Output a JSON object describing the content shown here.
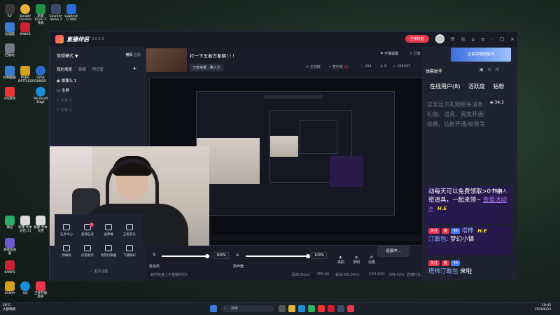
{
  "desktop": {
    "icons": [
      {
        "label": "TuF",
        "color": "#3a3a3a"
      },
      {
        "label": "Google Chrome",
        "color": "#e8b13a"
      },
      {
        "label": "新建 XLSX 工作表",
        "color": "#1f8f4a"
      },
      {
        "label": "Counter-Strike 2",
        "color": "#3b4a6b"
      },
      {
        "label": "Logitech G HUB",
        "color": "#2a6bd1"
      },
      {
        "label": "此电脑",
        "color": "#3a7bd5"
      },
      {
        "label": "KANAS",
        "color": "#c23"
      },
      {
        "label": "回收站",
        "color": "#778"
      },
      {
        "label": "控制面板",
        "color": "#3a7bd5"
      },
      {
        "label": "PUBG BATTLEGROUNDS",
        "color": "#d4a020"
      },
      {
        "label": "Orbit",
        "color": "#2a6bd1"
      },
      {
        "label": "QQ游戏",
        "color": "#e33"
      },
      {
        "label": "Microsoft Edge",
        "color": "#1b8dd8"
      },
      {
        "label": "微信",
        "color": "#2aae67"
      },
      {
        "label": "新建 文本文档 (2)",
        "color": "#ddd"
      },
      {
        "label": "新建 文本文档",
        "color": "#ddd"
      },
      {
        "label": "游戏加速器",
        "color": "#6a5acd"
      },
      {
        "label": "KANAS",
        "color": "#c23"
      },
      {
        "label": "SANYA",
        "color": "#d4a020"
      },
      {
        "label": "QQ",
        "color": "#1b8dd8"
      },
      {
        "label": "王者开播助手",
        "color": "#e8364a"
      }
    ]
  },
  "window": {
    "brand": "直播伴侣",
    "version": "6.5.8.3",
    "start_live_button": "主播权益",
    "menu_items": [
      "开播提醒",
      "分享"
    ],
    "window_controls": [
      "-",
      "□",
      "×"
    ]
  },
  "left_panel": {
    "mode_label": "常规模式",
    "orientation_options": [
      "横屏",
      "竖屏"
    ],
    "orientation_selected": "横屏",
    "scene_tabs": [
      "我的场景",
      "源模",
      "预览窗"
    ],
    "add_label": "+",
    "sources": [
      {
        "label": "摄像头 1",
        "active": true
      },
      {
        "label": "全屏",
        "active": true
      },
      {
        "label": "文本 2",
        "active": false
      },
      {
        "label": "文本 1",
        "active": false
      }
    ]
  },
  "stream_info": {
    "title": "打一下王者方象朝! ! !",
    "category": "王者荣耀 · 路人王",
    "fans_label": "全站榜",
    "rank_label": "签约榜",
    "rank_value": "22",
    "likes": "204",
    "viewers": "6",
    "heat": "166347"
  },
  "tools": [
    {
      "label": "任务中心",
      "badge": ""
    },
    {
      "label": "星期任务",
      "badge": "1"
    },
    {
      "label": "送弹幕",
      "badge": ""
    },
    {
      "label": "正版音乐",
      "badge": ""
    },
    {
      "label": "弹幕秀",
      "badge": ""
    },
    {
      "label": "房管助手",
      "badge": ""
    },
    {
      "label": "场景切换器",
      "badge": ""
    },
    {
      "label": "下播精彩",
      "badge": ""
    }
  ],
  "more_features": "更多功能",
  "controls": {
    "mic_label": "麦克风",
    "mic_value": "300%",
    "speaker_label": "扬声器",
    "speaker_value": "100%",
    "beauty_label": "美颜",
    "record_label": "录制",
    "settings_label": "设置",
    "connect_button": "连接中..."
  },
  "statusbar": {
    "tip": "如何快速上手直播伴侣?",
    "bitrate": "码率:0kb/s",
    "fps": "FPS:60",
    "dropped": "丢帧:0(0.00%)",
    "cpu": "CPU:19%",
    "memory": "内存:42%",
    "duration": "直播时长: 00:00:00"
  },
  "right_panel": {
    "ad_text": "王者荣耀技能节",
    "title": "弹幕助手",
    "tabs": [
      "在线用户(8)",
      "活跃度",
      "钻粉"
    ],
    "gift_tip": "这里显示礼物相关消息: 礼物、道具、贵族开通/续费、钻粉开通/续费等",
    "gift_count": "34.2",
    "chat": [
      {
        "text": "动每天可以免费领取>0个亲密道具，一起来领~",
        "link": "查看活动>",
        "count": "7条/4人"
      },
      {
        "user": "塔柿",
        "tag1": "关注",
        "tag2": "房",
        "level": "40",
        "medal": "H.E",
        "name_label": "汀敢包:",
        "message": "梦幻小镇"
      },
      {
        "user": "塔柿汀敢包",
        "tag1": "关注",
        "tag2": "房",
        "level": "40",
        "message": "来啦"
      }
    ]
  },
  "taskbar": {
    "weather_temp": "28°C",
    "weather_desc": "大部晴朗",
    "search_placeholder": "搜索",
    "time": "18:45",
    "date": "2026/6/23"
  },
  "colors": {
    "accent": "#e8364a",
    "panel": "#1f2230",
    "window": "#1a1d29",
    "chat_bg": "#281850",
    "link": "#b27bff"
  }
}
